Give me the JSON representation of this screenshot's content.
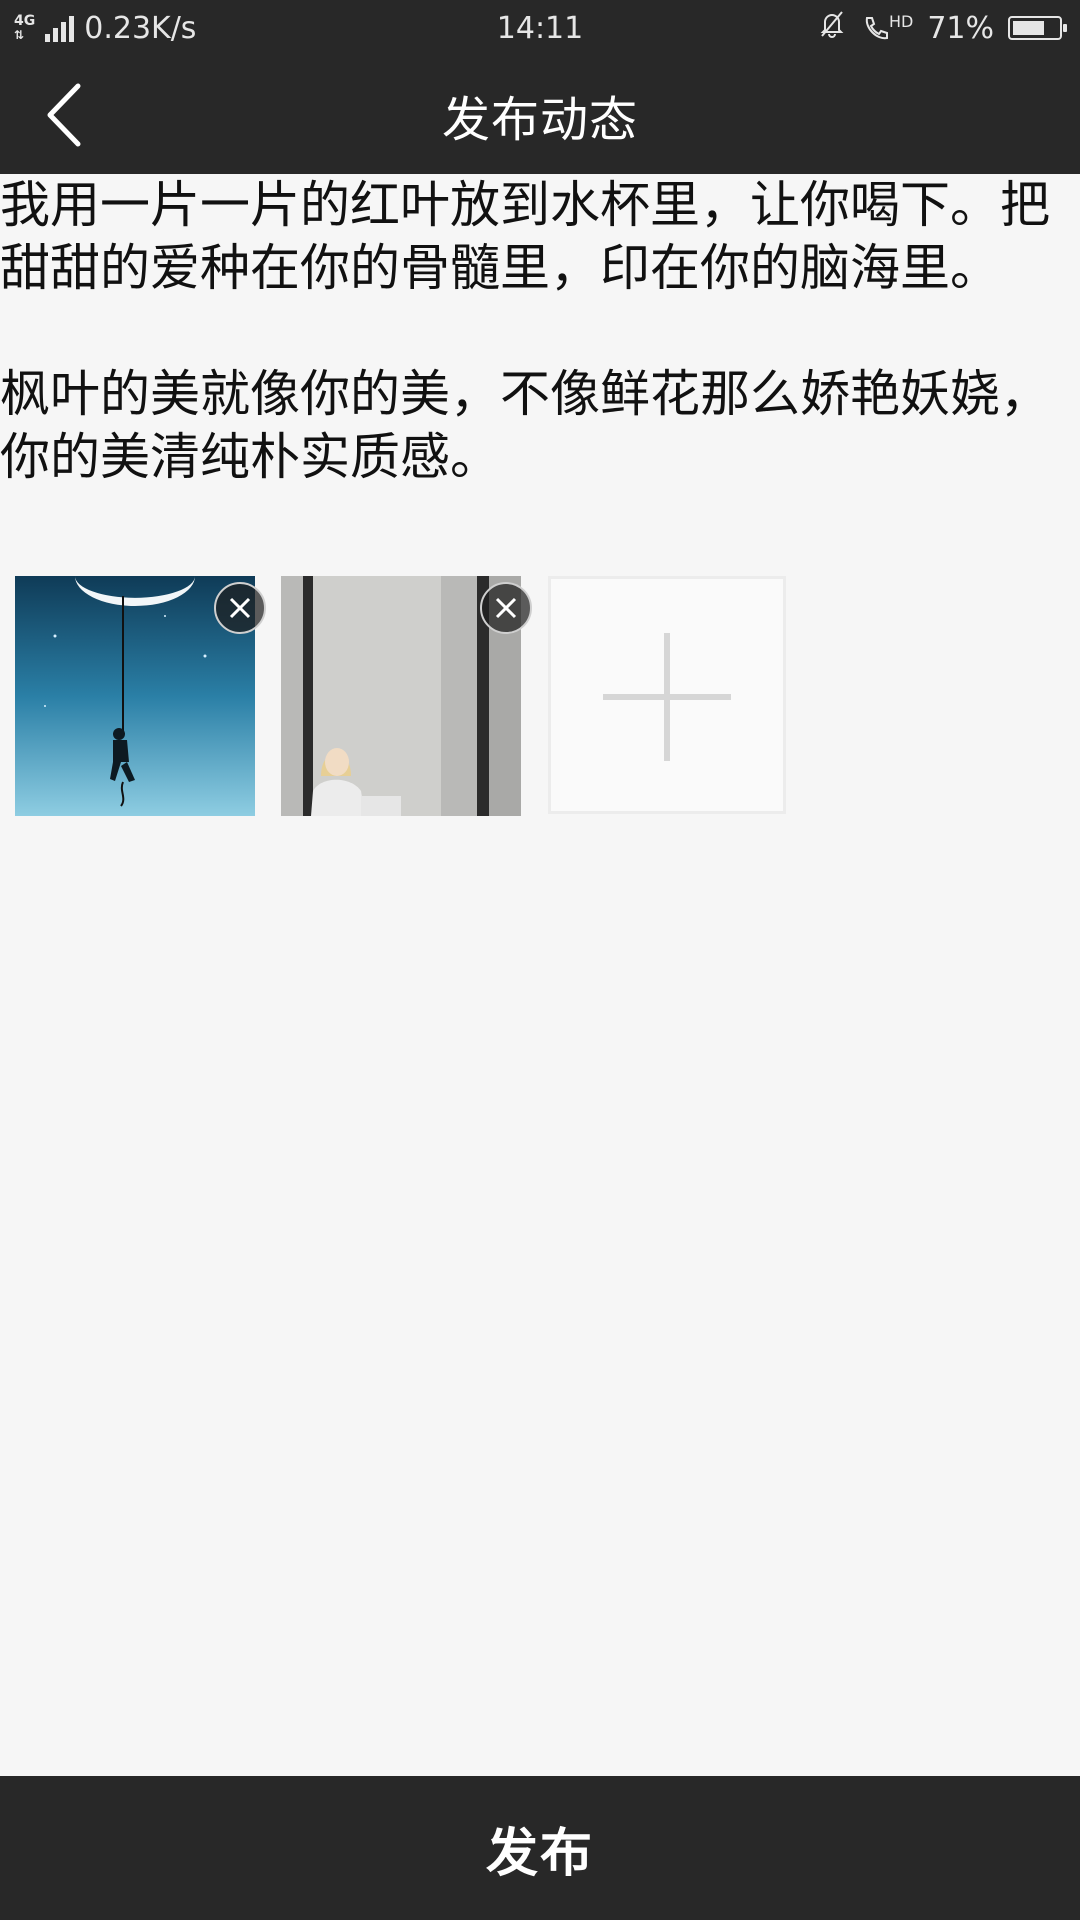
{
  "status_bar": {
    "network": "4G",
    "speed": "0.23K/s",
    "time": "14:11",
    "call_badge": "HD",
    "battery": "71%",
    "battery_level": 0.71,
    "icons": [
      "signal-icon",
      "mute-bell-icon",
      "hd-call-icon",
      "battery-icon"
    ]
  },
  "header": {
    "title": "发布动态",
    "back_icon": "chevron-left-icon"
  },
  "post": {
    "text": "我用一片一片的红叶放到水杯里，让你喝下。把甜甜的爱种在你的骨髓里，印在你的脑海里。\n\n枫叶的美就像你的美，不像鲜花那么娇艳妖娆，你的美清纯朴实质感。"
  },
  "attachments": {
    "images": [
      {
        "name": "night-moon-climber-image",
        "remove_icon": "close-icon"
      },
      {
        "name": "girl-by-window-image",
        "remove_icon": "close-icon"
      }
    ],
    "add_icon": "plus-icon"
  },
  "footer": {
    "publish_label": "发布"
  },
  "colors": {
    "bar_background": "#282828",
    "page_background": "#f6f6f6"
  }
}
